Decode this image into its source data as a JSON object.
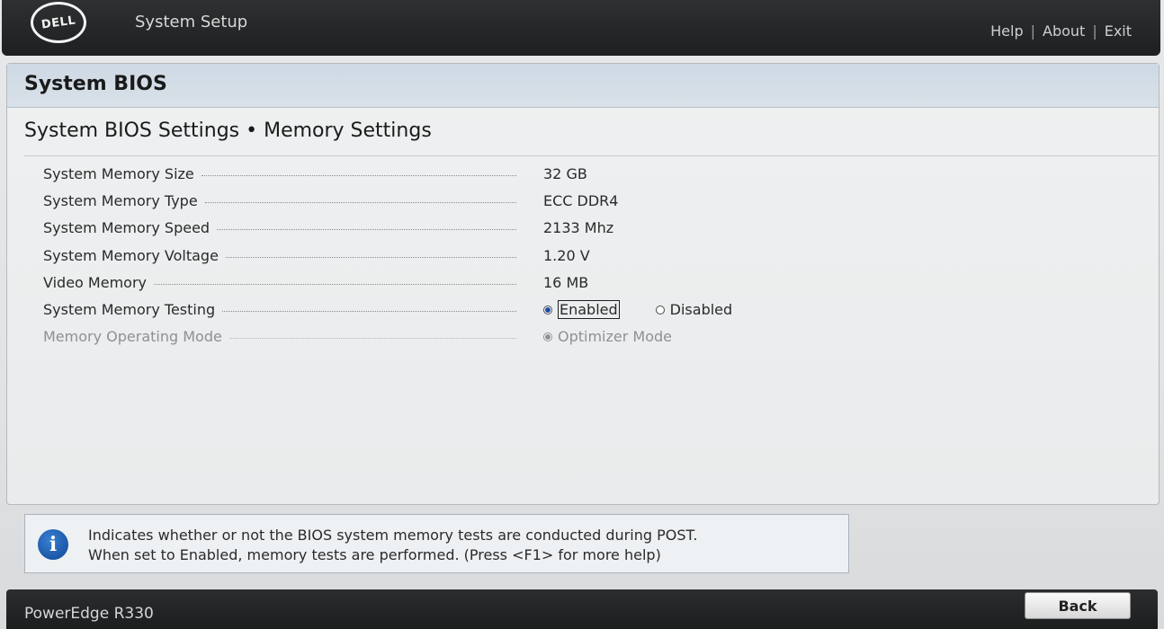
{
  "header": {
    "logo_text": "DELL",
    "app_title": "System Setup",
    "links": [
      "Help",
      "About",
      "Exit"
    ]
  },
  "panel": {
    "title": "System BIOS",
    "breadcrumb": "System BIOS Settings • Memory Settings"
  },
  "settings": [
    {
      "label": "System Memory Size",
      "value": "32 GB"
    },
    {
      "label": "System Memory Type",
      "value": "ECC DDR4"
    },
    {
      "label": "System Memory Speed",
      "value": "2133 Mhz"
    },
    {
      "label": "System Memory Voltage",
      "value": "1.20 V"
    },
    {
      "label": "Video Memory",
      "value": "16 MB"
    },
    {
      "label": "System Memory Testing",
      "options": [
        "Enabled",
        "Disabled"
      ],
      "selected": "Enabled"
    },
    {
      "label": "Memory Operating Mode",
      "options": [
        "Optimizer Mode"
      ],
      "selected": "Optimizer Mode",
      "disabled": true
    }
  ],
  "help": {
    "line1": "Indicates whether or not the BIOS system memory tests are conducted during POST.",
    "line2": "When set to Enabled, memory tests are performed. (Press <F1> for more help)"
  },
  "footer": {
    "model": "PowerEdge R330",
    "back_label": "Back"
  },
  "colors": {
    "header_bg": "#1d1f20",
    "panel_header_bg": "#cdd9e5",
    "radio_selected": "#1a4fa8",
    "info_icon": "#1a57a8"
  }
}
